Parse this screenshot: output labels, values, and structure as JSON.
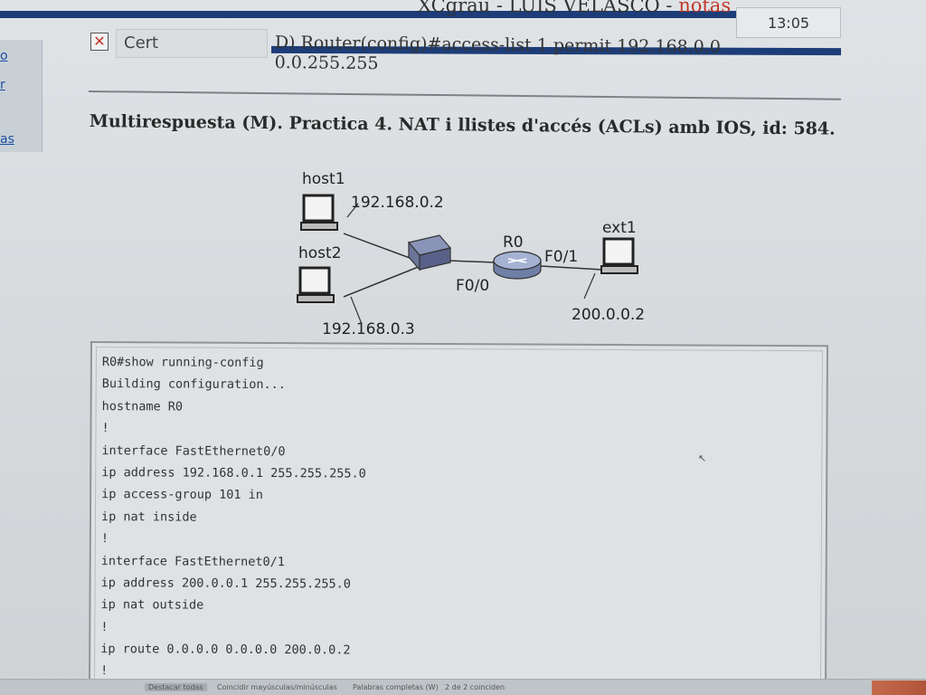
{
  "header": {
    "title_main": "XCgrau - LUIS VELASCO - ",
    "title_notas": "notas",
    "clock": "13:05"
  },
  "sidebar": {
    "links": [
      "o",
      "r",
      "as"
    ]
  },
  "answer": {
    "cert_label": "Cert",
    "cert_mark": "✕",
    "option_text": "D) Router(config)#access-list 1 permit 192.168.0.0 0.0.255.255"
  },
  "question": {
    "title": "Multirespuesta (M).   Practica 4. NAT i llistes d'accés (ACLs) amb IOS, id: 584."
  },
  "diagram": {
    "host1": "host1",
    "host1_ip": "192.168.0.2",
    "host2": "host2",
    "host2_ip": "192.168.0.3",
    "router": "R0",
    "if_inside": "F0/0",
    "if_outside": "F0/1",
    "ext": "ext1",
    "ext_ip": "200.0.0.2"
  },
  "terminal": {
    "lines": [
      "R0#show running-config",
      "Building configuration...",
      "hostname R0",
      "!",
      "interface FastEthernet0/0",
      "ip address 192.168.0.1 255.255.255.0",
      "ip access-group 101 in",
      "ip nat inside",
      "!",
      "interface FastEthernet0/1",
      "ip address 200.0.0.1 255.255.255.0",
      "ip nat outside",
      "!",
      "ip route 0.0.0.0 0.0.0.0 200.0.0.2",
      "!"
    ]
  },
  "findbar": {
    "highlight_all": "Destacar todas",
    "match_case": "Coincidir mayúsculas/minúsculas",
    "whole_words": "Palabras completas (W)",
    "matches": "2 de 2 coinciden"
  },
  "colors": {
    "header_bar": "#1d3d78",
    "notas": "#c0392b",
    "link": "#1a4fa0"
  }
}
